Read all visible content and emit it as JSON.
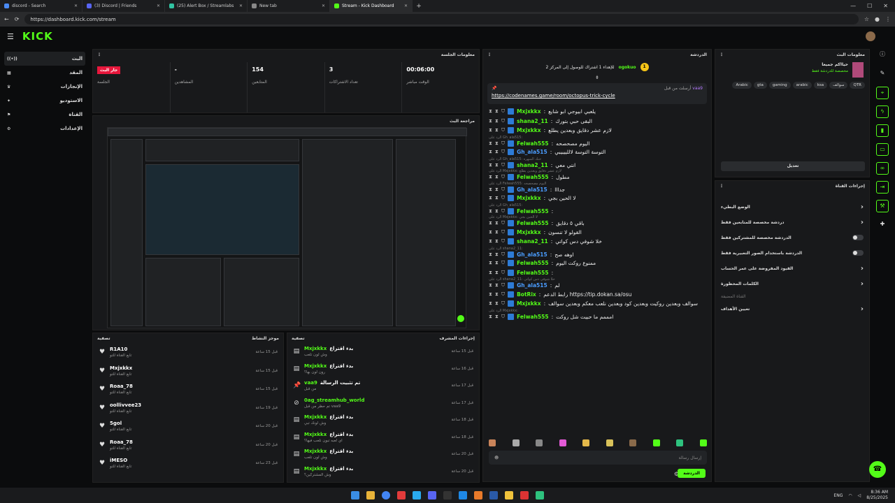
{
  "browser": {
    "tabs": [
      {
        "label": "discord - Search",
        "color": "#4a8af4"
      },
      {
        "label": "(3) Discord | Friends",
        "color": "#5865f2"
      },
      {
        "label": "(25) Alert Box / Streamlabs",
        "color": "#31c3a2"
      },
      {
        "label": "New tab",
        "color": "#888888"
      },
      {
        "label": "Stream - Kick Dashboard",
        "color": "#53fc18"
      }
    ],
    "url": "https://dashboard.kick.com/stream"
  },
  "brand": {
    "logo": "KICK",
    "accent": "#53fc18"
  },
  "left_nav": [
    {
      "label": "البث",
      "icon": "broadcast-icon"
    },
    {
      "label": "المقد",
      "icon": "content-icon"
    },
    {
      "label": "الإنجازات",
      "icon": "trophy-icon"
    },
    {
      "label": "الاستوديو",
      "icon": "studio-icon"
    },
    {
      "label": "القناة",
      "icon": "channel-icon"
    },
    {
      "label": "الإعدادات",
      "icon": "settings-icon"
    }
  ],
  "session": {
    "title": "معلومات الجلسة",
    "live_badge": "جار البث",
    "stats": [
      {
        "value": "",
        "label": "الجلسة"
      },
      {
        "value": "-",
        "label": "المشاهدين"
      },
      {
        "value": "154",
        "label": "المتابعين"
      },
      {
        "value": "3",
        "label": "تعداد الاشتراكات"
      },
      {
        "value": "00:06:00",
        "label": "الوقت مباشر"
      }
    ]
  },
  "preview": {
    "title": "مراجعة البث"
  },
  "activity_feed": {
    "title": "موجز النشاط",
    "filter": "تصفية",
    "items": [
      {
        "name": "R1A10",
        "sub": "تابع القناة للتو",
        "time": "قبل 15 ساعة"
      },
      {
        "name": "Mxjxkkx",
        "sub": "تابع القناة للتو",
        "time": "قبل 15 ساعة"
      },
      {
        "name": "Roaa_78",
        "sub": "تابع القناة للتو",
        "time": "قبل 15 ساعة"
      },
      {
        "name": "oollivvee23",
        "sub": "تابع القناة للتو",
        "time": "قبل 19 ساعة"
      },
      {
        "name": "5gol",
        "sub": "تابع القناة للتو",
        "time": "قبل 20 ساعة"
      },
      {
        "name": "Roaa_78",
        "sub": "تابع القناة للتو",
        "time": "قبل 20 ساعة"
      },
      {
        "name": "iMESO",
        "sub": "تابع القناة للتو",
        "time": "قبل 23 ساعة"
      }
    ]
  },
  "mod_actions": {
    "title": "إجراءات المشرف",
    "filter": "تصفية",
    "items": [
      {
        "name": "Mxjxkkx",
        "action": "بدء اقتراع",
        "sub": "وش لون تلعب",
        "time": "قبل 15 ساعة",
        "icon": "poll-icon"
      },
      {
        "name": "Mxjxkkx",
        "action": "بدء اقتراع",
        "sub": "رون لون بها؟",
        "time": "قبل 16 ساعة",
        "icon": "poll-icon"
      },
      {
        "name": "vaa9",
        "action": "تم تثبيت الرسالة",
        "sub": "من قبل",
        "time": "قبل 17 ساعة",
        "icon": "pin-icon"
      },
      {
        "name": "0ag_streamhub_world",
        "action": "",
        "sub": "تم حظر من قبل vaa9",
        "time": "قبل 17 ساعة",
        "icon": "ban-icon"
      },
      {
        "name": "Mxjxkkx",
        "action": "بدء اقتراع",
        "sub": "وش لونك تبي",
        "time": "قبل 18 ساعة",
        "icon": "poll-icon"
      },
      {
        "name": "Mxjxkkx",
        "action": "بدء اقتراع",
        "sub": "اي لعبه تبون نلعب فيها؟",
        "time": "قبل 18 ساعة",
        "icon": "poll-icon"
      },
      {
        "name": "Mxjxkkx",
        "action": "بدء اقتراع",
        "sub": "وش لون تلعب",
        "time": "قبل 20 ساعة",
        "icon": "poll-icon"
      },
      {
        "name": "Mxjxkkx",
        "action": "بدء اقتراع",
        "sub": "وش المشتركين؟",
        "time": "قبل 20 ساعة",
        "icon": "poll-icon"
      }
    ]
  },
  "chat": {
    "title": "الدردشة",
    "top_user": "ogokuo",
    "top_count": "1",
    "top_banner": "للإهداء 1 اشتراك للوصول إلى المركز 2",
    "pinned_by": "vaa9",
    "pinned_prefix": "أرسلت من قبل",
    "pinned_link": "https://codenames.game/room/octopus-trick-cycle",
    "messages": [
      {
        "user": "Mxjxkkx",
        "color": "#53fc18",
        "text": "يلعبي ابيوجي ابو شايع",
        "reply": ""
      },
      {
        "user": "shana2_11",
        "color": "#53fc18",
        "text": "البقى حبي بتورك",
        "reply": ""
      },
      {
        "user": "Mxjxkkx",
        "color": "#53fc18",
        "text": "لازم عشر دقايق وبعدين يطلع",
        "reply": ""
      },
      {
        "user": "Felwah555",
        "color": "#53fc18",
        "text": "اليوم مصحصحه",
        "reply": "الرد على Gh_ala515:"
      },
      {
        "user": "Gh_ala515",
        "color": "#4a9cff",
        "text": "التوسة التوسة لاللييبيبي",
        "reply": ""
      },
      {
        "user": "shana2_11",
        "color": "#53fc18",
        "text": "انتي معي",
        "reply": "الرد على Gh_ala515: حنك المبهره"
      },
      {
        "user": "Felwah555",
        "color": "#53fc18",
        "text": "مطول",
        "reply": "الرد على Mxjxkkx: لازم عشر دقايق وبعدين يطلع"
      },
      {
        "user": "Gh_ala515",
        "color": "#4a9cff",
        "text": "جدااا",
        "reply": "الرد على Felwah555: اليوم مصحصحه"
      },
      {
        "user": "Mxjxkkx",
        "color": "#53fc18",
        "text": "لا الحين بجي",
        "reply": ""
      },
      {
        "user": "Felwah555",
        "color": "#53fc18",
        "text": "",
        "reply": "الرد على Gh_ala515:"
      },
      {
        "user": "Felwah555",
        "color": "#53fc18",
        "text": "باقي ٥ دقايق",
        "reply": "الرد على Mxjxkkx: لا الحين بجي"
      },
      {
        "user": "Mxjxkkx",
        "color": "#53fc18",
        "text": "القولو لا تنسون",
        "reply": ""
      },
      {
        "user": "shana2_11",
        "color": "#53fc18",
        "text": "خلا شوفي دس كواتي",
        "reply": ""
      },
      {
        "user": "Gh_ala515",
        "color": "#4a9cff",
        "text": "اوهه صح",
        "reply": "الرد على shana2_11:"
      },
      {
        "user": "Felwah555",
        "color": "#53fc18",
        "text": "ممنوع روكت اليوم",
        "reply": ""
      },
      {
        "user": "Felwah555",
        "color": "#53fc18",
        "text": "",
        "reply": ""
      },
      {
        "user": "Gh_ala515",
        "color": "#4a9cff",
        "text": "لم",
        "reply": "الرد على shana2_11: خلا شوفي دس كواتي"
      },
      {
        "user": "BotRix",
        "color": "#53fc18",
        "text": "رابط الدعم https://tip.dokan.sa/osu",
        "reply": ""
      },
      {
        "user": "Mxjxkkx",
        "color": "#53fc18",
        "text": "سوالف وبعدين روكيت وبعدين كود وبعدين نلعب معكم وبعدين سوالف",
        "reply": ""
      },
      {
        "user": "Felwah555",
        "color": "#53fc18",
        "text": "امممم ما حبيت شل روكت",
        "reply": "الرد على Mxjxkkx:"
      }
    ],
    "input_placeholder": "إرسال رسالة",
    "send_label": "الدردشة"
  },
  "stream_info": {
    "title": "معلومات البث",
    "stream_title": "حيااكم جميعا",
    "category": "مخصصة للدردشة فقط",
    "tags": [
      "Arabic",
      "gta",
      "gaming",
      "arabic",
      "ksa",
      "سوالف",
      "QTR"
    ],
    "edit_label": "تعديل"
  },
  "channel_actions": {
    "title": "إجراءات القناة",
    "items": [
      {
        "label": "الوضع البطيء",
        "control": "arrow"
      },
      {
        "label": "دردشة مخصصة للمتابعين فقط",
        "control": "arrow"
      },
      {
        "label": "الدردشة مخصصة للمشتركين فقط",
        "control": "toggle"
      },
      {
        "label": "الدردشة باستخدام الصور التعبيرية فقط",
        "control": "toggle"
      },
      {
        "label": "القيود المفروضة على عمر الحساب",
        "control": "arrow"
      },
      {
        "label": "الكلمات المحظورة",
        "control": "arrow"
      },
      {
        "label": "القناة المضيفة",
        "control": "note"
      },
      {
        "label": "تعيين الأهداف",
        "control": "arrow"
      }
    ]
  },
  "taskbar": {
    "lang": "ENG",
    "time": "8:36 AM",
    "date": "8/25/2025"
  }
}
